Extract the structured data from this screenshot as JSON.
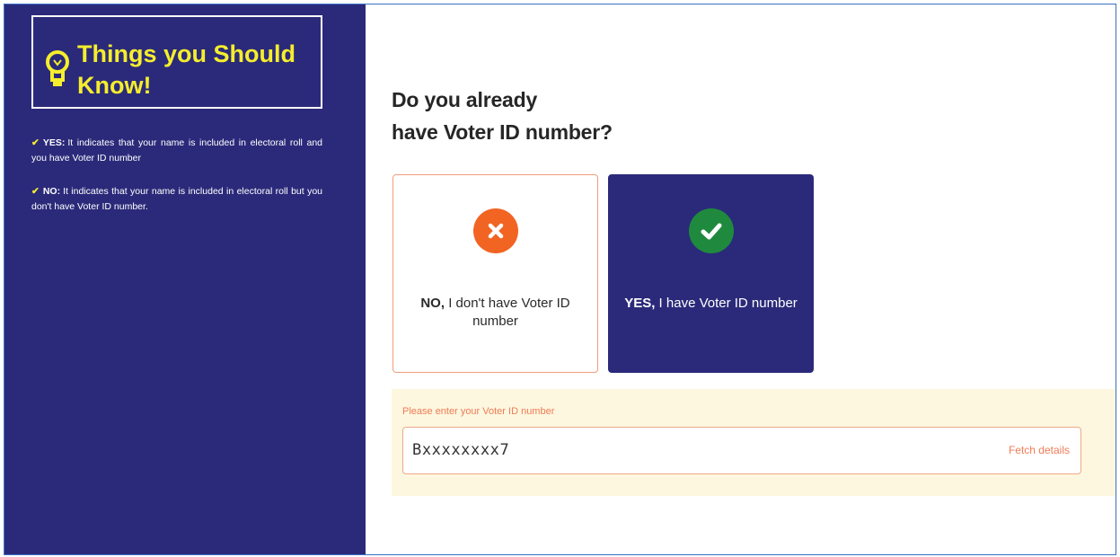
{
  "sidebar": {
    "title": "Things you Should Know!",
    "tips": [
      {
        "key": "YES:",
        "text": "It indicates that your name is included in electoral roll and you have Voter ID number"
      },
      {
        "key": "NO:",
        "text": "It indicates that your name is included in electoral roll but you don't have Voter ID number."
      }
    ]
  },
  "main": {
    "question_line1": "Do you already",
    "question_line2": "have Voter ID number?",
    "options": {
      "no": {
        "bold": "NO,",
        "text": "I don't have Voter ID number",
        "icon": "close-circle-icon"
      },
      "yes": {
        "bold": "YES,",
        "text": "I have Voter ID number",
        "icon": "check-circle-icon",
        "selected": true
      }
    },
    "voter_id": {
      "label": "Please enter your Voter ID number",
      "value": "Bxxxxxxxx7",
      "fetch_label": "Fetch details"
    }
  },
  "colors": {
    "navy": "#2b2a7a",
    "yellow": "#f5ee2c",
    "orange": "#f26422",
    "green": "#1f8a3d",
    "panel_bg": "#fdf7df"
  }
}
